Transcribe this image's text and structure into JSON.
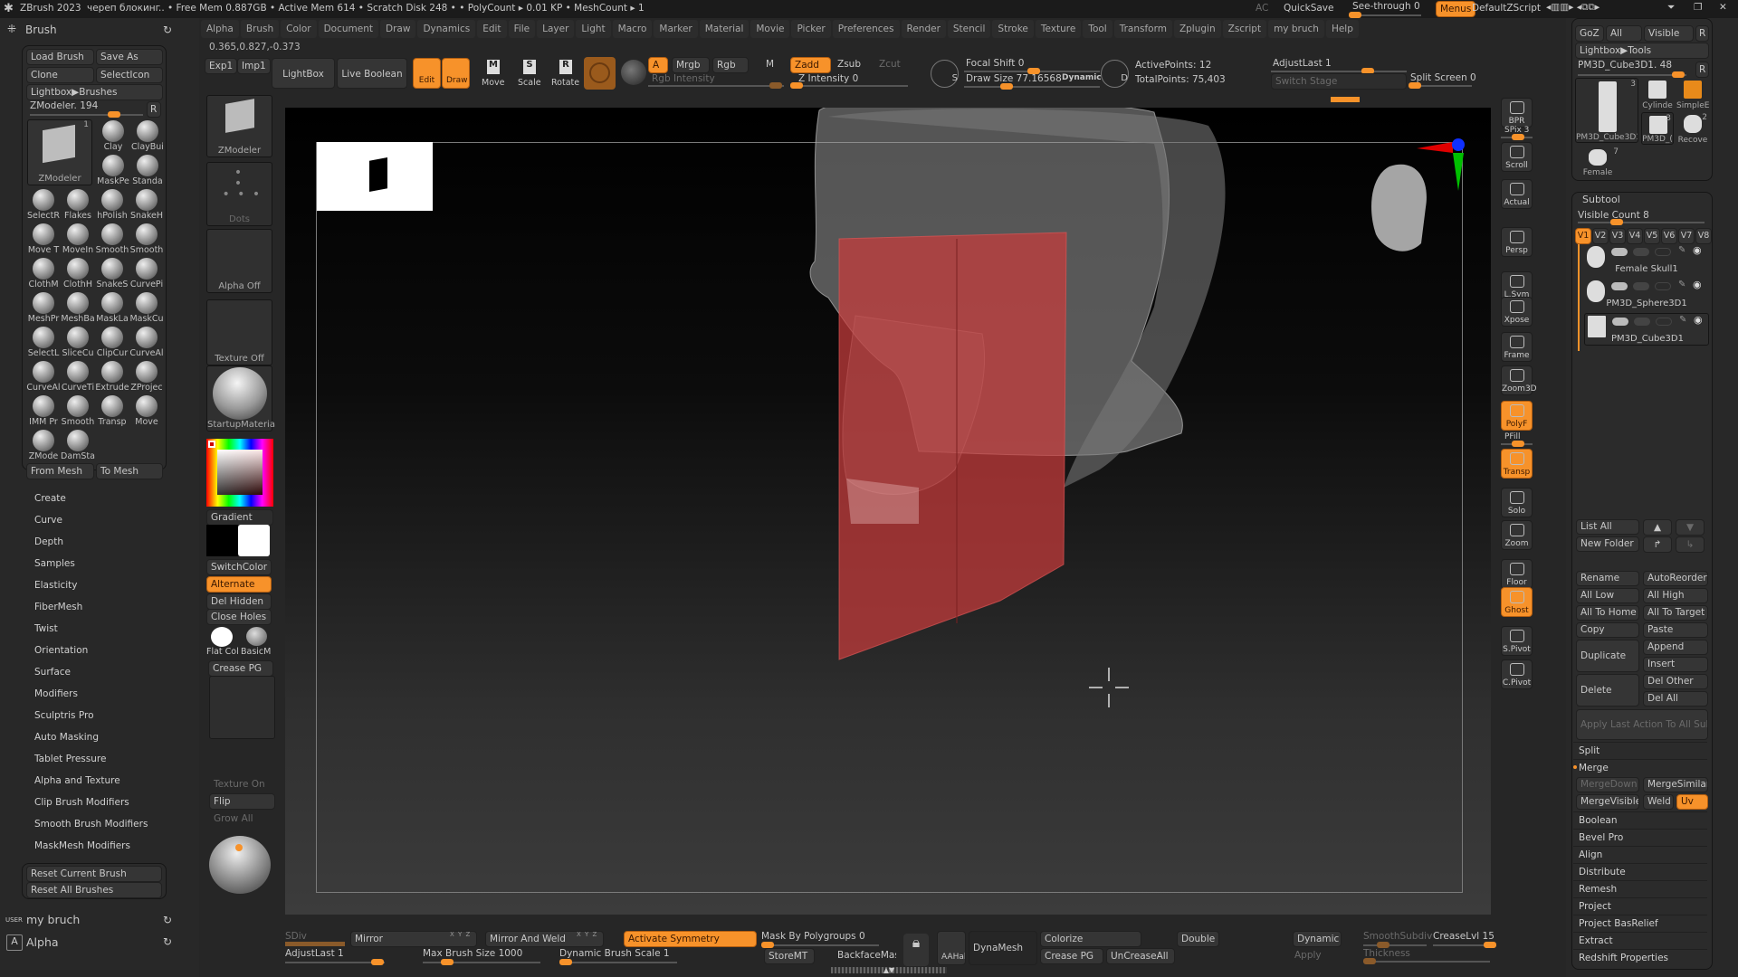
{
  "titlebar": {
    "app": "ZBrush 2023",
    "document": "череп блокинг",
    "stats": ".. • Free Mem 0.887GB • Active Mem 614 • Scratch Disk 248 • • PolyCount ▸ 0.01 KP • MeshCount ▸ 1",
    "ac": "AC",
    "quicksave": "QuickSave",
    "see_through": "See-through  0",
    "see_through_value": 0,
    "menus": "Menus",
    "default_zscript": "DefaultZScript"
  },
  "menus": [
    "Alpha",
    "Brush",
    "Color",
    "Document",
    "Draw",
    "Dynamics",
    "Edit",
    "File",
    "Layer",
    "Light",
    "Macro",
    "Marker",
    "Material",
    "Movie",
    "Picker",
    "Preferences",
    "Render",
    "Stencil",
    "Stroke",
    "Texture",
    "Tool",
    "Transform",
    "Zplugin",
    "Zscript",
    "my bruch",
    "Help"
  ],
  "coords": "0.365,0.827,-0.373",
  "toolbar": {
    "exp1": "Exp1",
    "imp1": "Imp1",
    "lightbox": "LightBox",
    "live_boolean": "Live Boolean",
    "edit": "Edit",
    "draw": "Draw",
    "move": "Move",
    "scale": "Scale",
    "rotate": "Rotate",
    "a": "A",
    "mrgb": "Mrgb",
    "rgb": "Rgb",
    "m": "M",
    "zadd": "Zadd",
    "zsub": "Zsub",
    "zcut": "Zcut",
    "rgb_intensity": "Rgb Intensity",
    "z_intensity": "Z Intensity 0",
    "focal_shift": "Focal Shift 0",
    "draw_size": "Draw Size 77.16568",
    "dynamic": "Dynamic",
    "active_points": "ActivePoints: 12",
    "total_points": "TotalPoints: 75,403",
    "adjust_last": "AdjustLast 1",
    "switch_stage": "Switch Stage",
    "split_screen": "Split Screen 0",
    "s_label": "S",
    "d_label": "D"
  },
  "left_panel": {
    "title": "Brush",
    "load_brush": "Load Brush",
    "save_as": "Save As",
    "clone": "Clone",
    "select_icon": "SelectIcon",
    "lightbox_brushes": "Lightbox▶Brushes",
    "zmodeler_slider": "ZModeler. 194",
    "r": "R",
    "current_brush": "ZModeler",
    "current_brush_count": "1",
    "brushes": [
      "Clay",
      "ClayBui",
      "MaskPe",
      "Standa",
      "SelectR",
      "Flakes",
      "hPolish",
      "SnakeH",
      "Move T",
      "MoveIn",
      "Smooth",
      "Smooth",
      "ClothM",
      "ClothH",
      "SnakeS",
      "CurvePi",
      "MeshPr",
      "MeshBa",
      "MaskLa",
      "MaskCu",
      "SelectL",
      "SliceCu",
      "ClipCur",
      "CurveAl",
      "CurveAl",
      "CurveTi",
      "Extrude",
      "ZProjec",
      "IMM Pr",
      "Smooth",
      "Transp",
      "Move",
      "ZMode",
      "DamSta"
    ],
    "from_mesh": "From Mesh",
    "to_mesh": "To Mesh",
    "sections": [
      "Create",
      "Curve",
      "Depth",
      "Samples",
      "Elasticity",
      "FiberMesh",
      "Twist",
      "Orientation",
      "Surface",
      "Modifiers",
      "Sculptris Pro",
      "Auto Masking",
      "Tablet Pressure",
      "Alpha and Texture",
      "Clip Brush Modifiers",
      "Smooth Brush Modifiers",
      "MaskMesh Modifiers"
    ],
    "reset_current": "Reset Current Brush",
    "reset_all": "Reset All Brushes",
    "user_tag": "USER",
    "my_bruch": "my bruch",
    "alpha": "Alpha",
    "alpha_icon_letter": "A"
  },
  "shelf": {
    "zmodeler": "ZModeler",
    "dots": "Dots",
    "alpha_off": "Alpha Off",
    "texture_off": "Texture Off",
    "material": "StartupMateria",
    "gradient": "Gradient",
    "switch_color": "SwitchColor",
    "alternate": "Alternate",
    "del_hidden": "Del Hidden",
    "close_holes": "Close Holes",
    "flat_col": "Flat Col",
    "basic_m": "BasicM",
    "crease_pg": "Crease PG",
    "texture_on": "Texture On",
    "flip": "Flip",
    "grow_all": "Grow All",
    "main_color": "#000000",
    "secondary_color": "#ffffff"
  },
  "right_shelf": [
    {
      "label": "BPR",
      "icon": "bpr-icon"
    },
    {
      "label": "SPix 3",
      "icon": "spix-slider"
    },
    {
      "label": "Scroll",
      "icon": "hand-scroll-icon"
    },
    {
      "label": "Actual",
      "icon": "zoom-actual-icon"
    },
    {
      "label": "Persp",
      "icon": "perspective-grid-icon"
    },
    {
      "label": "L.Sym",
      "icon": "local-symmetry-icon"
    },
    {
      "label": "Xpose",
      "icon": "xpose-icon"
    },
    {
      "label": "Frame",
      "icon": "frame-icon"
    },
    {
      "label": "Zoom3D",
      "icon": "zoom3d-icon"
    },
    {
      "label": "PolyF",
      "icon": "polyframe-icon",
      "active": true
    },
    {
      "label": "PFill",
      "icon": "pfill-slider"
    },
    {
      "label": "Transp",
      "icon": "transparency-icon",
      "active": true
    },
    {
      "label": "Solo",
      "icon": "solo-icon"
    },
    {
      "label": "Zoom",
      "icon": "zoom-icon"
    },
    {
      "label": "Floor",
      "icon": "floor-icon"
    },
    {
      "label": "Ghost",
      "icon": "ghost-icon",
      "active": true
    },
    {
      "label": "S.Pivot",
      "icon": "set-pivot-icon"
    },
    {
      "label": "C.Pivot",
      "icon": "clear-pivot-icon"
    }
  ],
  "tool_panel": {
    "goz": "GoZ",
    "all": "All",
    "visible": "Visible",
    "r": "R",
    "lightbox_tools": "Lightbox▶Tools",
    "current_tool": "PM3D_Cube3D1. 48",
    "tools": [
      {
        "name": "PM3D_Cube3D1",
        "count": "3"
      },
      {
        "name": "Cylinde",
        "count": ""
      },
      {
        "name": "SimpleE",
        "count": ""
      },
      {
        "name": "PM3D_(",
        "count": "3"
      },
      {
        "name": "Recove",
        "count": "2"
      },
      {
        "name": "Female",
        "count": "7"
      }
    ]
  },
  "subtool": {
    "title": "Subtool",
    "visible_count": "Visible Count  8",
    "versions": [
      "V1",
      "V2",
      "V3",
      "V4",
      "V5",
      "V6",
      "V7",
      "V8"
    ],
    "items": [
      "Female Skull1",
      "PM3D_Sphere3D1",
      "PM3D_Cube3D1"
    ],
    "list_all": "List All",
    "new_folder": "New Folder",
    "rename": "Rename",
    "auto_reorder": "AutoReorder",
    "all_low": "All Low",
    "all_high": "All High",
    "all_to_home": "All To Home",
    "all_to_target": "All To Target",
    "copy": "Copy",
    "paste": "Paste",
    "duplicate": "Duplicate",
    "append": "Append",
    "insert": "Insert",
    "delete": "Delete",
    "del_other": "Del Other",
    "del_all": "Del All",
    "apply_last": "Apply Last Action To All Subtoo",
    "split": "Split",
    "merge": "Merge",
    "merge_down": "MergeDown",
    "merge_similar": "MergeSimilar",
    "merge_visible": "MergeVisible",
    "weld": "Weld",
    "uv": "Uv",
    "sections": [
      "Boolean",
      "Bevel Pro",
      "Align",
      "Distribute",
      "Remesh",
      "Project",
      "Project BasRelief",
      "Extract",
      "Redshift Properties"
    ]
  },
  "bottom": {
    "sdiv": "SDiv",
    "mirror": "Mirror",
    "mirror_weld": "Mirror And Weld",
    "activate_symmetry": "Activate Symmetry",
    "mask_by_pg": "Mask By Polygroups 0",
    "store_mt": "StoreMT",
    "backface_mask": "BackfaceMask",
    "aahalf": "AAHalf",
    "dynamesh": "DynaMesh",
    "colorize": "Colorize",
    "crease_pg": "Crease PG",
    "uncrease_all": "UnCreaseAll",
    "double": "Double",
    "dynamic": "Dynamic",
    "apply": "Apply",
    "smooth_subdiv": "SmoothSubdiv",
    "crease_lvl": "CreaseLvl 15",
    "thickness": "Thickness",
    "adjust_last": "AdjustLast 1",
    "max_brush_size": "Max Brush Size 1000",
    "dynamic_brush_scale": "Dynamic Brush Scale 1",
    "xyz": "X Y Z"
  },
  "colors": {
    "accent": "#f7922a",
    "panel": "#2b2b2b",
    "mask_red": "#c83c3c"
  }
}
